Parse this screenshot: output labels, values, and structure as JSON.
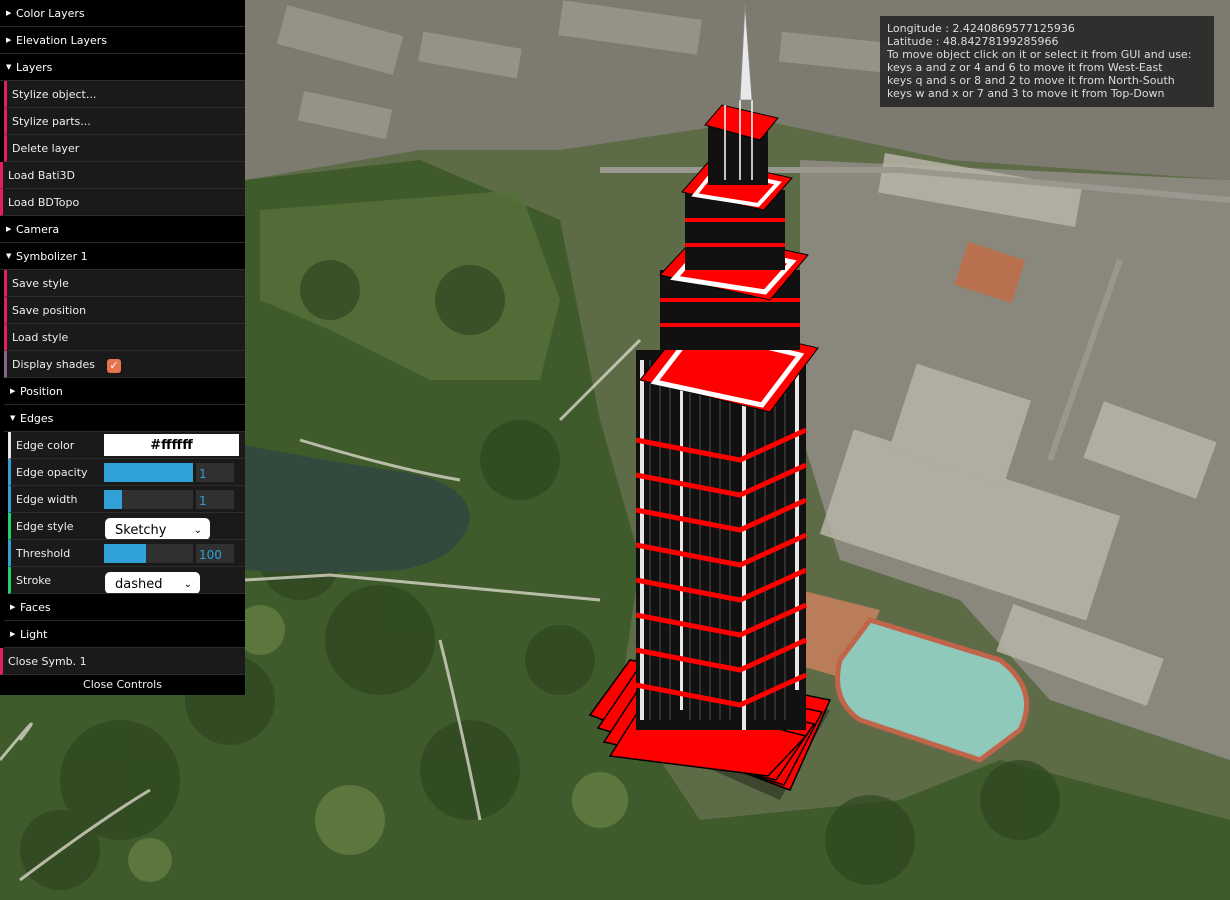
{
  "gui": {
    "folders": {
      "color_layers": "Color Layers",
      "elevation_layers": "Elevation Layers",
      "layers": "Layers",
      "camera": "Camera",
      "symbolizer": "Symbolizer 1",
      "position": "Position",
      "edges": "Edges",
      "faces": "Faces",
      "light": "Light"
    },
    "layers_items": {
      "stylize_object": "Stylize object...",
      "stylize_parts": "Stylize parts...",
      "delete_layer": "Delete layer"
    },
    "load_bati3d": "Load Bati3D",
    "load_bdtopo": "Load BDTopo",
    "symbolizer_items": {
      "save_style": "Save style",
      "save_position": "Save position",
      "load_style": "Load style",
      "display_shades": "Display shades",
      "display_shades_checked": true
    },
    "edges": {
      "color_label": "Edge color",
      "color_value": "#ffffff",
      "opacity_label": "Edge opacity",
      "opacity_value": "1",
      "opacity_fraction": 1.0,
      "width_label": "Edge width",
      "width_value": "1",
      "width_fraction": 0.2,
      "style_label": "Edge style",
      "style_value": "Sketchy",
      "threshold_label": "Threshold",
      "threshold_value": "100",
      "threshold_fraction": 0.47,
      "stroke_label": "Stroke",
      "stroke_value": "dashed"
    },
    "close_symb": "Close Symb. 1",
    "close_controls": "Close Controls"
  },
  "info": {
    "longitude": "Longitude : 2.4240869577125936",
    "latitude": "Latitude : 48.84278199285966",
    "line1": "To move object click on it or select it from GUI and use:",
    "line2": "keys a and z or 4 and 6 to move it from West-East",
    "line3": "keys q and s or 8 and 2 to move it from North-South",
    "line4": "keys w and x or 7 and 3 to move it from Top-Down"
  },
  "colors": {
    "building_edge": "#ffffff",
    "building_face": "#ff0000",
    "function_accent": "#e61d5f",
    "number_accent": "#2fa1d6",
    "string_accent": "#1ed36f"
  }
}
